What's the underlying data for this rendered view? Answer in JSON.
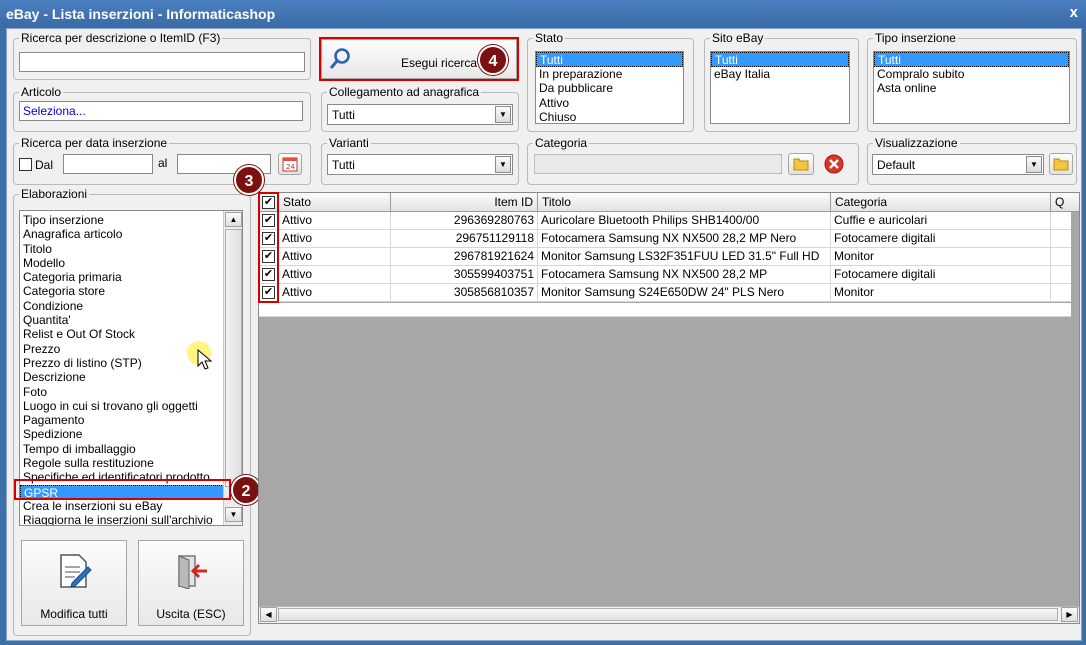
{
  "window": {
    "title": "eBay - Lista inserzioni - Informaticashop",
    "close": "x"
  },
  "search": {
    "label": "Ricerca per descrizione o ItemID (F3)",
    "value": "",
    "button": "Esegui ricerca"
  },
  "articolo": {
    "label": "Articolo",
    "value": "Seleziona..."
  },
  "collegamento": {
    "label": "Collegamento ad anagrafica",
    "value": "Tutti"
  },
  "data": {
    "label": "Ricerca per data inserzione",
    "dal": "Dal",
    "al": "al",
    "dal_value": "",
    "al_value": ""
  },
  "varianti": {
    "label": "Varianti",
    "value": "Tutti"
  },
  "stato": {
    "label": "Stato",
    "items": [
      "Tutti",
      "In preparazione",
      "Da pubblicare",
      "Attivo",
      "Chiuso"
    ]
  },
  "sito": {
    "label": "Sito eBay",
    "items": [
      "Tutti",
      "eBay Italia"
    ]
  },
  "tipo": {
    "label": "Tipo inserzione",
    "items": [
      "Tutti",
      "Compralo subito",
      "Asta online"
    ]
  },
  "categoria": {
    "label": "Categoria",
    "value": ""
  },
  "visualizzazione": {
    "label": "Visualizzazione",
    "value": "Default"
  },
  "elaborazioni": {
    "label": "Elaborazioni",
    "items": [
      "Tipo inserzione",
      "Anagrafica articolo",
      "Titolo",
      "Modello",
      "Categoria primaria",
      "Categoria store",
      "Condizione",
      "Quantita'",
      "Relist e Out Of Stock",
      "Prezzo",
      "Prezzo di listino (STP)",
      "Descrizione",
      "Foto",
      "Luogo in cui si trovano gli oggetti",
      "Pagamento",
      "Spedizione",
      "Tempo di imballaggio",
      "Regole sulla restituzione",
      "Specifiche ed identificatori prodotto",
      "GPSR",
      "Crea le inserzioni su eBay",
      "Riaggiorna le inserzioni sull'archivio"
    ],
    "selected": "GPSR"
  },
  "buttons": {
    "modifica": "Modifica tutti",
    "uscita": "Uscita (ESC)"
  },
  "badges": {
    "b2": "2",
    "b3": "3",
    "b4": "4"
  },
  "grid": {
    "columns": [
      "Stato",
      "Item ID",
      "Titolo",
      "Categoria",
      "Q"
    ],
    "rows": [
      {
        "stato": "Attivo",
        "id": "296369280763",
        "titolo": "Auricolare Bluetooth Philips SHB1400/00",
        "categoria": "Cuffie e auricolari"
      },
      {
        "stato": "Attivo",
        "id": "296751129118",
        "titolo": "Fotocamera Samsung NX NX500 28,2 MP Nero",
        "categoria": "Fotocamere digitali"
      },
      {
        "stato": "Attivo",
        "id": "296781921624",
        "titolo": "Monitor Samsung LS32F351FUU LED 31.5\" Full HD",
        "categoria": "Monitor"
      },
      {
        "stato": "Attivo",
        "id": "305599403751",
        "titolo": "Fotocamera Samsung NX NX500 28,2 MP",
        "categoria": "Fotocamere digitali"
      },
      {
        "stato": "Attivo",
        "id": "305856810357",
        "titolo": "Monitor Samsung S24E650DW 24\" PLS Nero",
        "categoria": "Monitor"
      }
    ]
  },
  "colors": {
    "selection": "#3399ff",
    "highlight_border": "#d40000",
    "badge": "#7a1010",
    "titlebar": "#3f6fa8"
  }
}
